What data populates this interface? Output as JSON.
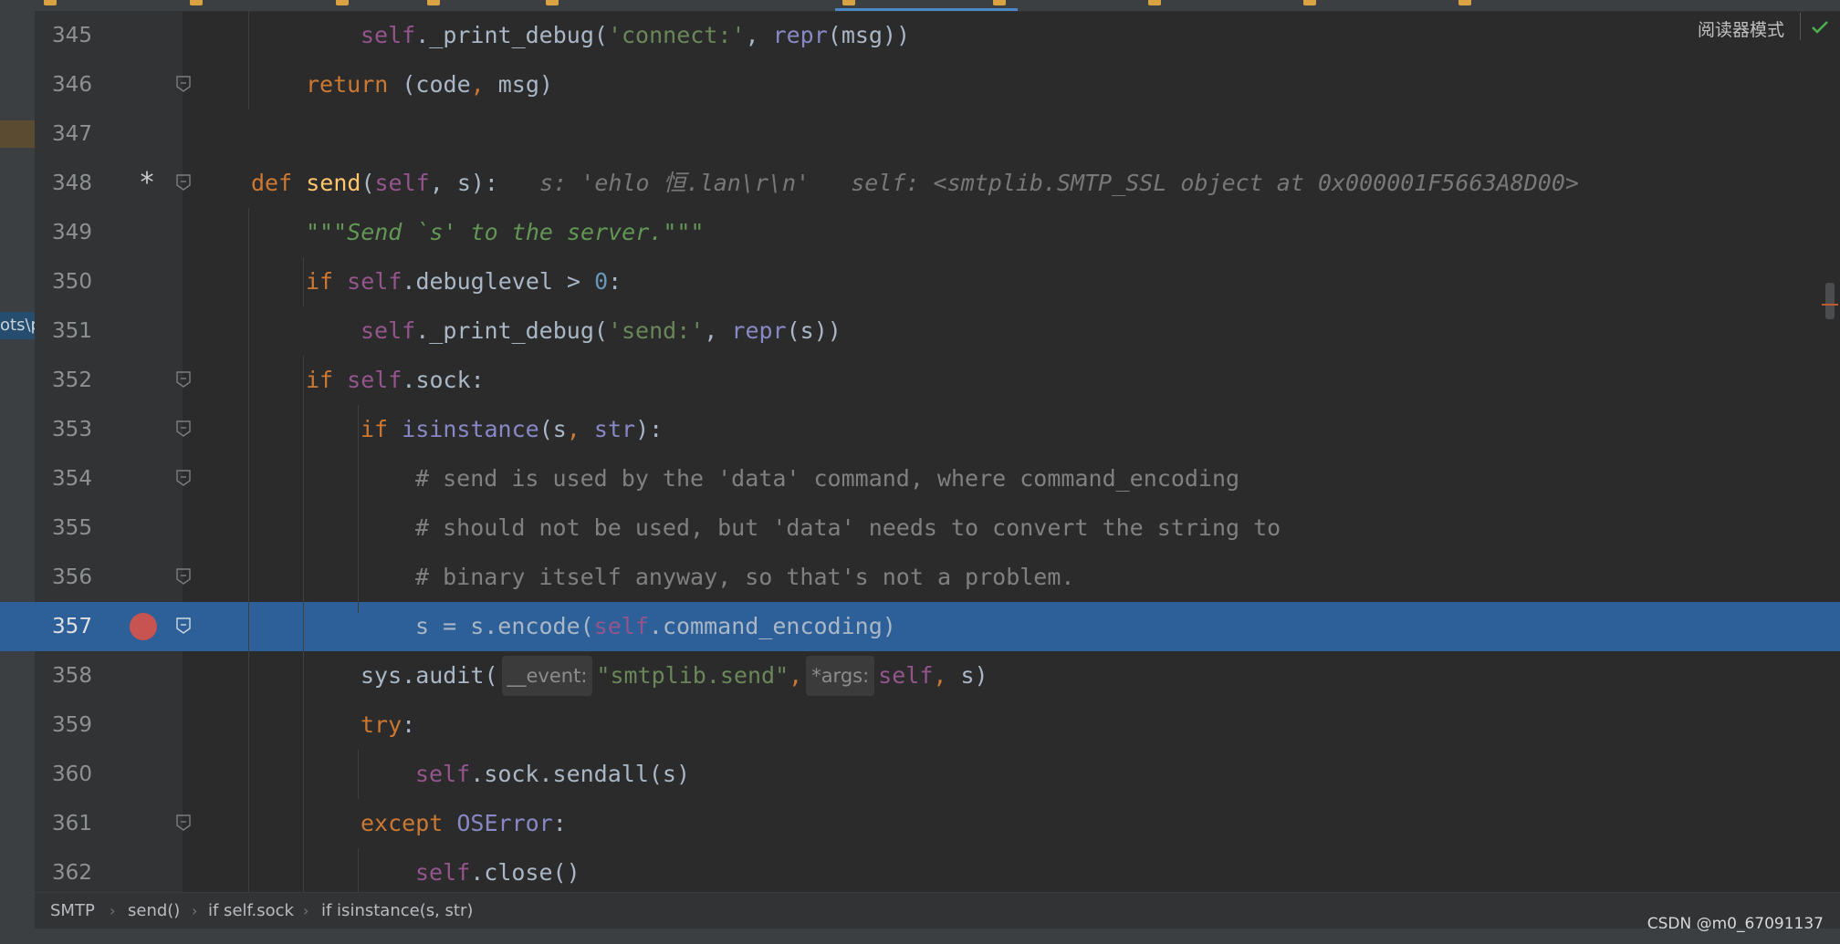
{
  "editor": {
    "reader_mode_label": "阅读器模式",
    "left_path_fragment": "ots\\p"
  },
  "lines": [
    {
      "num": "345",
      "code": [
        [
          "self",
          "self"
        ],
        [
          "",
          "._print_debug("
        ],
        [
          "str",
          "'connect:'"
        ],
        [
          "",
          ", "
        ],
        [
          "builtin",
          "repr"
        ],
        [
          "",
          "(msg))"
        ]
      ]
    },
    {
      "num": "346",
      "code": [
        [
          "kw",
          "return"
        ],
        [
          "",
          " (code"
        ],
        [
          "kw",
          ","
        ],
        [
          "",
          " msg)"
        ]
      ]
    },
    {
      "num": "347",
      "code": []
    },
    {
      "num": "348",
      "code": [
        [
          "kw",
          "def"
        ],
        [
          "",
          " "
        ],
        [
          "fn",
          "send"
        ],
        [
          "",
          "("
        ],
        [
          "self",
          "self"
        ],
        [
          "",
          ", s):  "
        ],
        [
          "inlay",
          " s: 'ehlo 恒.lan\\r\\n'   self: <smtplib.SMTP_SSL object at 0x000001F5663A8D00>"
        ]
      ]
    },
    {
      "num": "349",
      "code": [
        [
          "doc",
          "\"\"\"Send `s' to the server.\"\"\""
        ]
      ]
    },
    {
      "num": "350",
      "code": [
        [
          "kw",
          "if"
        ],
        [
          "",
          " "
        ],
        [
          "self",
          "self"
        ],
        [
          "",
          ".debuglevel > "
        ],
        [
          "num",
          "0"
        ],
        [
          "",
          ":"
        ]
      ]
    },
    {
      "num": "351",
      "code": [
        [
          "self",
          "self"
        ],
        [
          "",
          "._print_debug("
        ],
        [
          "str",
          "'send:'"
        ],
        [
          "",
          ", "
        ],
        [
          "builtin",
          "repr"
        ],
        [
          "",
          "(s))"
        ]
      ]
    },
    {
      "num": "352",
      "code": [
        [
          "kw",
          "if"
        ],
        [
          "",
          " "
        ],
        [
          "self",
          "self"
        ],
        [
          "",
          ".sock:"
        ]
      ]
    },
    {
      "num": "353",
      "code": [
        [
          "kw",
          "if"
        ],
        [
          "",
          " "
        ],
        [
          "builtin",
          "isinstance"
        ],
        [
          "",
          "(s"
        ],
        [
          "kw",
          ","
        ],
        [
          "",
          " "
        ],
        [
          "builtin",
          "str"
        ],
        [
          "",
          "):"
        ]
      ]
    },
    {
      "num": "354",
      "code": [
        [
          "cmt",
          "# send is used by the 'data' command, where command_encoding"
        ]
      ]
    },
    {
      "num": "355",
      "code": [
        [
          "cmt",
          "# should not be used, but 'data' needs to convert the string to"
        ]
      ]
    },
    {
      "num": "356",
      "code": [
        [
          "cmt",
          "# binary itself anyway, so that's not a problem."
        ]
      ]
    },
    {
      "num": "357",
      "code": [
        [
          "",
          "s = s.encode("
        ],
        [
          "self",
          "self"
        ],
        [
          "",
          ".command_encoding)"
        ]
      ]
    },
    {
      "num": "358",
      "code": [
        [
          "",
          "sys.audit("
        ],
        [
          "hint",
          "__event:"
        ],
        [
          "str",
          "\"smtplib.send\""
        ],
        [
          "kw",
          ","
        ],
        [
          "",
          ""
        ],
        [
          "hint",
          "*args:"
        ],
        [
          "self",
          "self"
        ],
        [
          "kw",
          ","
        ],
        [
          "",
          " s)"
        ]
      ]
    },
    {
      "num": "359",
      "code": [
        [
          "kw",
          "try"
        ],
        [
          "",
          ":"
        ]
      ]
    },
    {
      "num": "360",
      "code": [
        [
          "self",
          "self"
        ],
        [
          "",
          ".sock.sendall(s)"
        ]
      ]
    },
    {
      "num": "361",
      "code": [
        [
          "kw",
          "except"
        ],
        [
          "",
          " "
        ],
        [
          "builtin",
          "OSError"
        ],
        [
          "",
          ":"
        ]
      ]
    },
    {
      "num": "362",
      "code": [
        [
          "self",
          "self"
        ],
        [
          "",
          ".close()"
        ]
      ]
    }
  ],
  "breadcrumb": [
    "SMTP",
    "send()",
    "if self.sock",
    "if isinstance(s, str)"
  ],
  "watermark": "CSDN @m0_67091137",
  "colors": {
    "background": "#2b2b2b",
    "current_line": "#2d5f99",
    "breakpoint": "#c75450",
    "keyword": "#cc7832",
    "string": "#6a8759"
  }
}
